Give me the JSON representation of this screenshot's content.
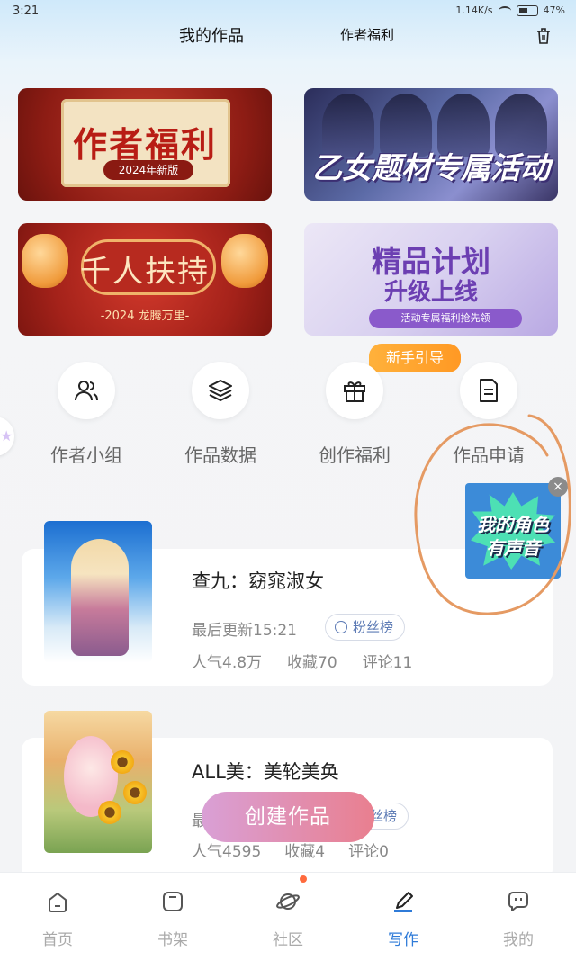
{
  "status_bar": {
    "time": "3:21",
    "speed": "1.14K/s",
    "battery": "47%"
  },
  "header": {
    "tab_works": "我的作品",
    "tab_benefit": "作者福利",
    "trash_icon": "trash-icon"
  },
  "banners": [
    {
      "title": "作者福利",
      "sub": "2024年新版"
    },
    {
      "title": "乙女题材专属活动"
    },
    {
      "title": "千人扶持",
      "sub": "-2024 龙腾万里-"
    },
    {
      "title": "精品计划",
      "line2": "升级上线",
      "sub": "活动专属福利抢先领"
    }
  ],
  "newbie_badge": "新手引导",
  "entries": [
    {
      "label": "作者小组",
      "icon": "group-icon"
    },
    {
      "label": "作品数据",
      "icon": "layers-icon"
    },
    {
      "label": "创作福利",
      "icon": "gift-icon"
    },
    {
      "label": "作品申请",
      "icon": "document-icon"
    }
  ],
  "float_ad": {
    "line1": "我的角色",
    "line2": "有声音"
  },
  "works": [
    {
      "title": "查九：窈窕淑女",
      "updated": "最后更新15:21",
      "fans": "粉丝榜",
      "popularity": "人气4.8万",
      "favorites": "收藏70",
      "comments": "评论11"
    },
    {
      "title": "ALL美：美轮美奂",
      "updated_prefix": "最",
      "fans": "丝榜",
      "popularity": "人气4595",
      "favorites": "收藏4",
      "comments": "评论0"
    }
  ],
  "create_button": "创建作品",
  "bottom_nav": [
    {
      "label": "首页",
      "icon": "home-icon"
    },
    {
      "label": "书架",
      "icon": "bookshelf-icon"
    },
    {
      "label": "社区",
      "icon": "planet-icon"
    },
    {
      "label": "写作",
      "icon": "pen-icon",
      "active": true
    },
    {
      "label": "我的",
      "icon": "chat-icon"
    }
  ],
  "colors": {
    "accent": "#2f7bd8",
    "orange": "#ff9924",
    "create_start": "#d9a0d6",
    "create_end": "#e97f8f"
  }
}
